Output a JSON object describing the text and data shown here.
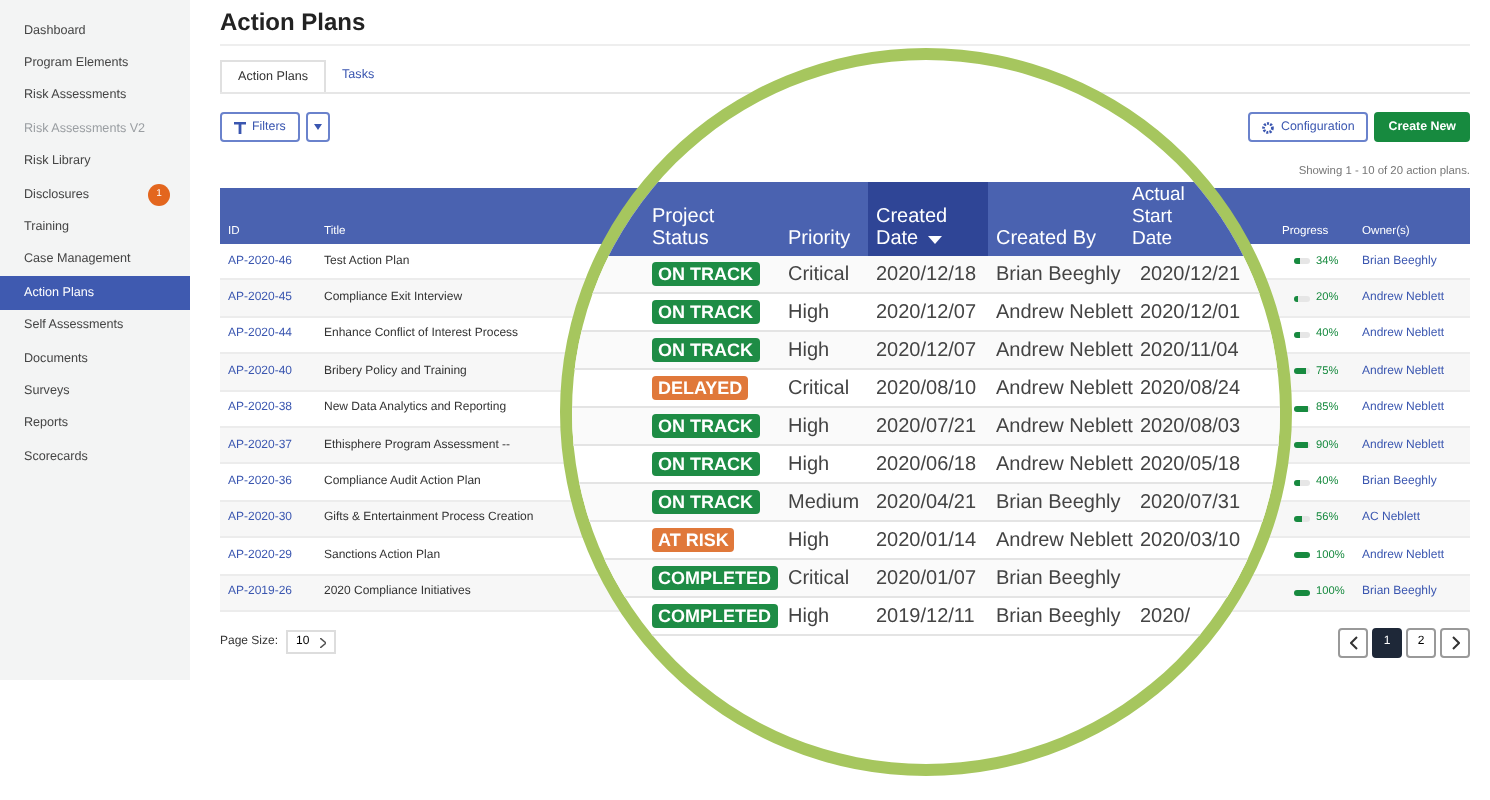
{
  "sidebar": {
    "items": [
      {
        "label": "Dashboard",
        "selected": false,
        "disabled": false
      },
      {
        "label": "Program Elements",
        "selected": false,
        "disabled": false
      },
      {
        "label": "Risk Assessments",
        "selected": false,
        "disabled": false
      },
      {
        "label": "Risk Assessments V2",
        "selected": false,
        "disabled": true
      },
      {
        "label": "Risk Library",
        "selected": false,
        "disabled": false
      },
      {
        "label": "Disclosures",
        "selected": false,
        "disabled": false,
        "badge": "1"
      },
      {
        "label": "Training",
        "selected": false,
        "disabled": false
      },
      {
        "label": "Case Management",
        "selected": false,
        "disabled": false
      },
      {
        "label": "Action Plans",
        "selected": true,
        "disabled": false
      },
      {
        "label": "Self Assessments",
        "selected": false,
        "disabled": false
      },
      {
        "label": "Documents",
        "selected": false,
        "disabled": false
      },
      {
        "label": "Surveys",
        "selected": false,
        "disabled": false
      },
      {
        "label": "Reports",
        "selected": false,
        "disabled": false
      },
      {
        "label": "Scorecards",
        "selected": false,
        "disabled": false
      }
    ]
  },
  "title": "Action Plans",
  "tabs": [
    {
      "label": "Action Plans",
      "selected": true
    },
    {
      "label": "Tasks",
      "selected": false
    }
  ],
  "filters_button": "Filters",
  "configuration_button": "Configuration",
  "create_button": "Create New",
  "showing": "Showing 1 - 10 of 20 action plans.",
  "table": {
    "columns": [
      "ID",
      "Title",
      "Progress",
      "Owner(s)"
    ],
    "rows": [
      {
        "id": "AP-2020-46",
        "title": "Test Action Plan",
        "progress": "34%",
        "level": 0.34,
        "owner": "Brian Beeghly"
      },
      {
        "id": "AP-2020-45",
        "title": "Compliance Exit Interview",
        "progress": "20%",
        "level": 0.2,
        "owner": "Andrew Neblett"
      },
      {
        "id": "AP-2020-44",
        "title": "Enhance Conflict of Interest Process",
        "progress": "40%",
        "level": 0.4,
        "owner": "Andrew Neblett"
      },
      {
        "id": "AP-2020-40",
        "title": "Bribery Policy and Training",
        "progress": "75%",
        "level": 0.75,
        "owner": "Andrew Neblett"
      },
      {
        "id": "AP-2020-38",
        "title": "New Data Analytics and Reporting",
        "progress": "85%",
        "level": 0.85,
        "owner": "Andrew Neblett"
      },
      {
        "id": "AP-2020-37",
        "title": "Ethisphere Program Assessment --",
        "progress": "90%",
        "level": 0.9,
        "owner": "Andrew Neblett"
      },
      {
        "id": "AP-2020-36",
        "title": "Compliance Audit Action Plan",
        "progress": "40%",
        "level": 0.4,
        "owner": "Brian Beeghly"
      },
      {
        "id": "AP-2020-30",
        "title": "Gifts & Entertainment Process Creation",
        "progress": "56%",
        "level": 0.56,
        "owner": "AC Neblett"
      },
      {
        "id": "AP-2020-29",
        "title": "Sanctions Action Plan",
        "progress": "100%",
        "level": 1,
        "owner": "Andrew Neblett"
      },
      {
        "id": "AP-2019-26",
        "title": "2020 Compliance Initiatives",
        "progress": "100%",
        "level": 1,
        "owner": "Brian Beeghly"
      }
    ]
  },
  "page_size": {
    "label": "Page Size:",
    "value": "10"
  },
  "pages": [
    {
      "label": "1",
      "selected": true
    },
    {
      "label": "2",
      "selected": false
    }
  ],
  "magnifier": {
    "columns": [
      {
        "label": "Project Status",
        "sorted": false
      },
      {
        "label": "Priority",
        "sorted": false
      },
      {
        "label": "Created Date",
        "sorted": true
      },
      {
        "label": "Created By",
        "sorted": false
      },
      {
        "label": "Actual Start Date",
        "sorted": false
      }
    ],
    "rows": [
      {
        "status": "ON TRACK",
        "color": "#1e8c45",
        "priority": "Critical",
        "created": "2020/12/18",
        "created_by": "Brian Beeghly",
        "start": "2020/12/21"
      },
      {
        "status": "ON TRACK",
        "color": "#1e8c45",
        "priority": "High",
        "created": "2020/12/07",
        "created_by": "Andrew Neblett",
        "start": "2020/12/01"
      },
      {
        "status": "ON TRACK",
        "color": "#1e8c45",
        "priority": "High",
        "created": "2020/12/07",
        "created_by": "Andrew Neblett",
        "start": "2020/11/04"
      },
      {
        "status": "DELAYED",
        "color": "#e0783a",
        "priority": "Critical",
        "created": "2020/08/10",
        "created_by": "Andrew Neblett",
        "start": "2020/08/24"
      },
      {
        "status": "ON TRACK",
        "color": "#1e8c45",
        "priority": "High",
        "created": "2020/07/21",
        "created_by": "Andrew Neblett",
        "start": "2020/08/03"
      },
      {
        "status": "ON TRACK",
        "color": "#1e8c45",
        "priority": "High",
        "created": "2020/06/18",
        "created_by": "Andrew Neblett",
        "start": "2020/05/18"
      },
      {
        "status": "ON TRACK",
        "color": "#1e8c45",
        "priority": "Medium",
        "created": "2020/04/21",
        "created_by": "Brian Beeghly",
        "start": "2020/07/31"
      },
      {
        "status": "AT RISK",
        "color": "#e0783a",
        "priority": "High",
        "created": "2020/01/14",
        "created_by": "Andrew Neblett",
        "start": "2020/03/10"
      },
      {
        "status": "COMPLETED",
        "color": "#1e8c45",
        "priority": "Critical",
        "created": "2020/01/07",
        "created_by": "Brian Beeghly"
      },
      {
        "status": "COMPLETED",
        "color": "#1e8c45",
        "priority": "High",
        "created": "2019/12/11",
        "created_by": "Brian Beeghly",
        "start": "2020/"
      }
    ]
  }
}
